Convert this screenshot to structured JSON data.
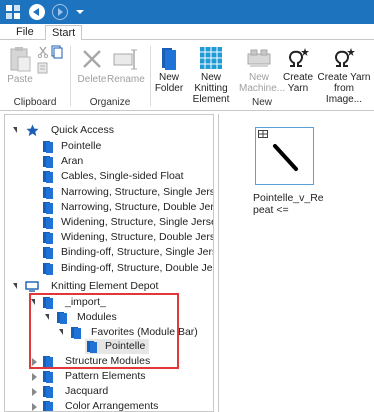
{
  "titlebar": {
    "colors": {
      "bg": "#1e73be"
    }
  },
  "tabs": {
    "file": "File",
    "start": "Start"
  },
  "ribbon": {
    "clipboard": {
      "paste": "Paste",
      "group_label": "Clipboard"
    },
    "organize": {
      "delete": "Delete",
      "rename": "Rename",
      "group_label": "Organize"
    },
    "new": {
      "new_folder": [
        "New",
        "Folder"
      ],
      "new_knitting_element": [
        "New Knitting",
        "Element"
      ],
      "new_machine": [
        "New",
        "Machine..."
      ],
      "create_yarn": [
        "Create",
        "Yarn"
      ],
      "create_yarn_from_image": [
        "Create Yarn",
        "from Image..."
      ],
      "group_label": "New"
    }
  },
  "tree": {
    "quick_access": "Quick Access",
    "quick_access_items": [
      "Pointelle",
      "Aran",
      "Cables, Single-sided Float",
      "Narrowing, Structure, Single Jersey",
      "Narrowing, Structure, Double Jersey",
      "Widening, Structure, Single Jersey",
      "Widening, Structure, Double Jersey",
      "Binding-off, Structure, Single Jersey",
      "Binding-off, Structure, Double Jersey"
    ],
    "depot": "Knitting Element Depot",
    "import": "_import_",
    "modules": "Modules",
    "favorites": "Favorites (Module Bar)",
    "pointelle_selected": "Pointelle",
    "depot_children": [
      "Structure Modules",
      "Pattern Elements",
      "Jacquard",
      "Color Arrangements"
    ]
  },
  "content": {
    "item_caption": "Pointelle_v_Repeat <="
  },
  "colors": {
    "accent": "#1e73be",
    "highlight": "#e0383a",
    "selection": "#e6e6e6",
    "icon_blue": "#1a5fb4"
  }
}
